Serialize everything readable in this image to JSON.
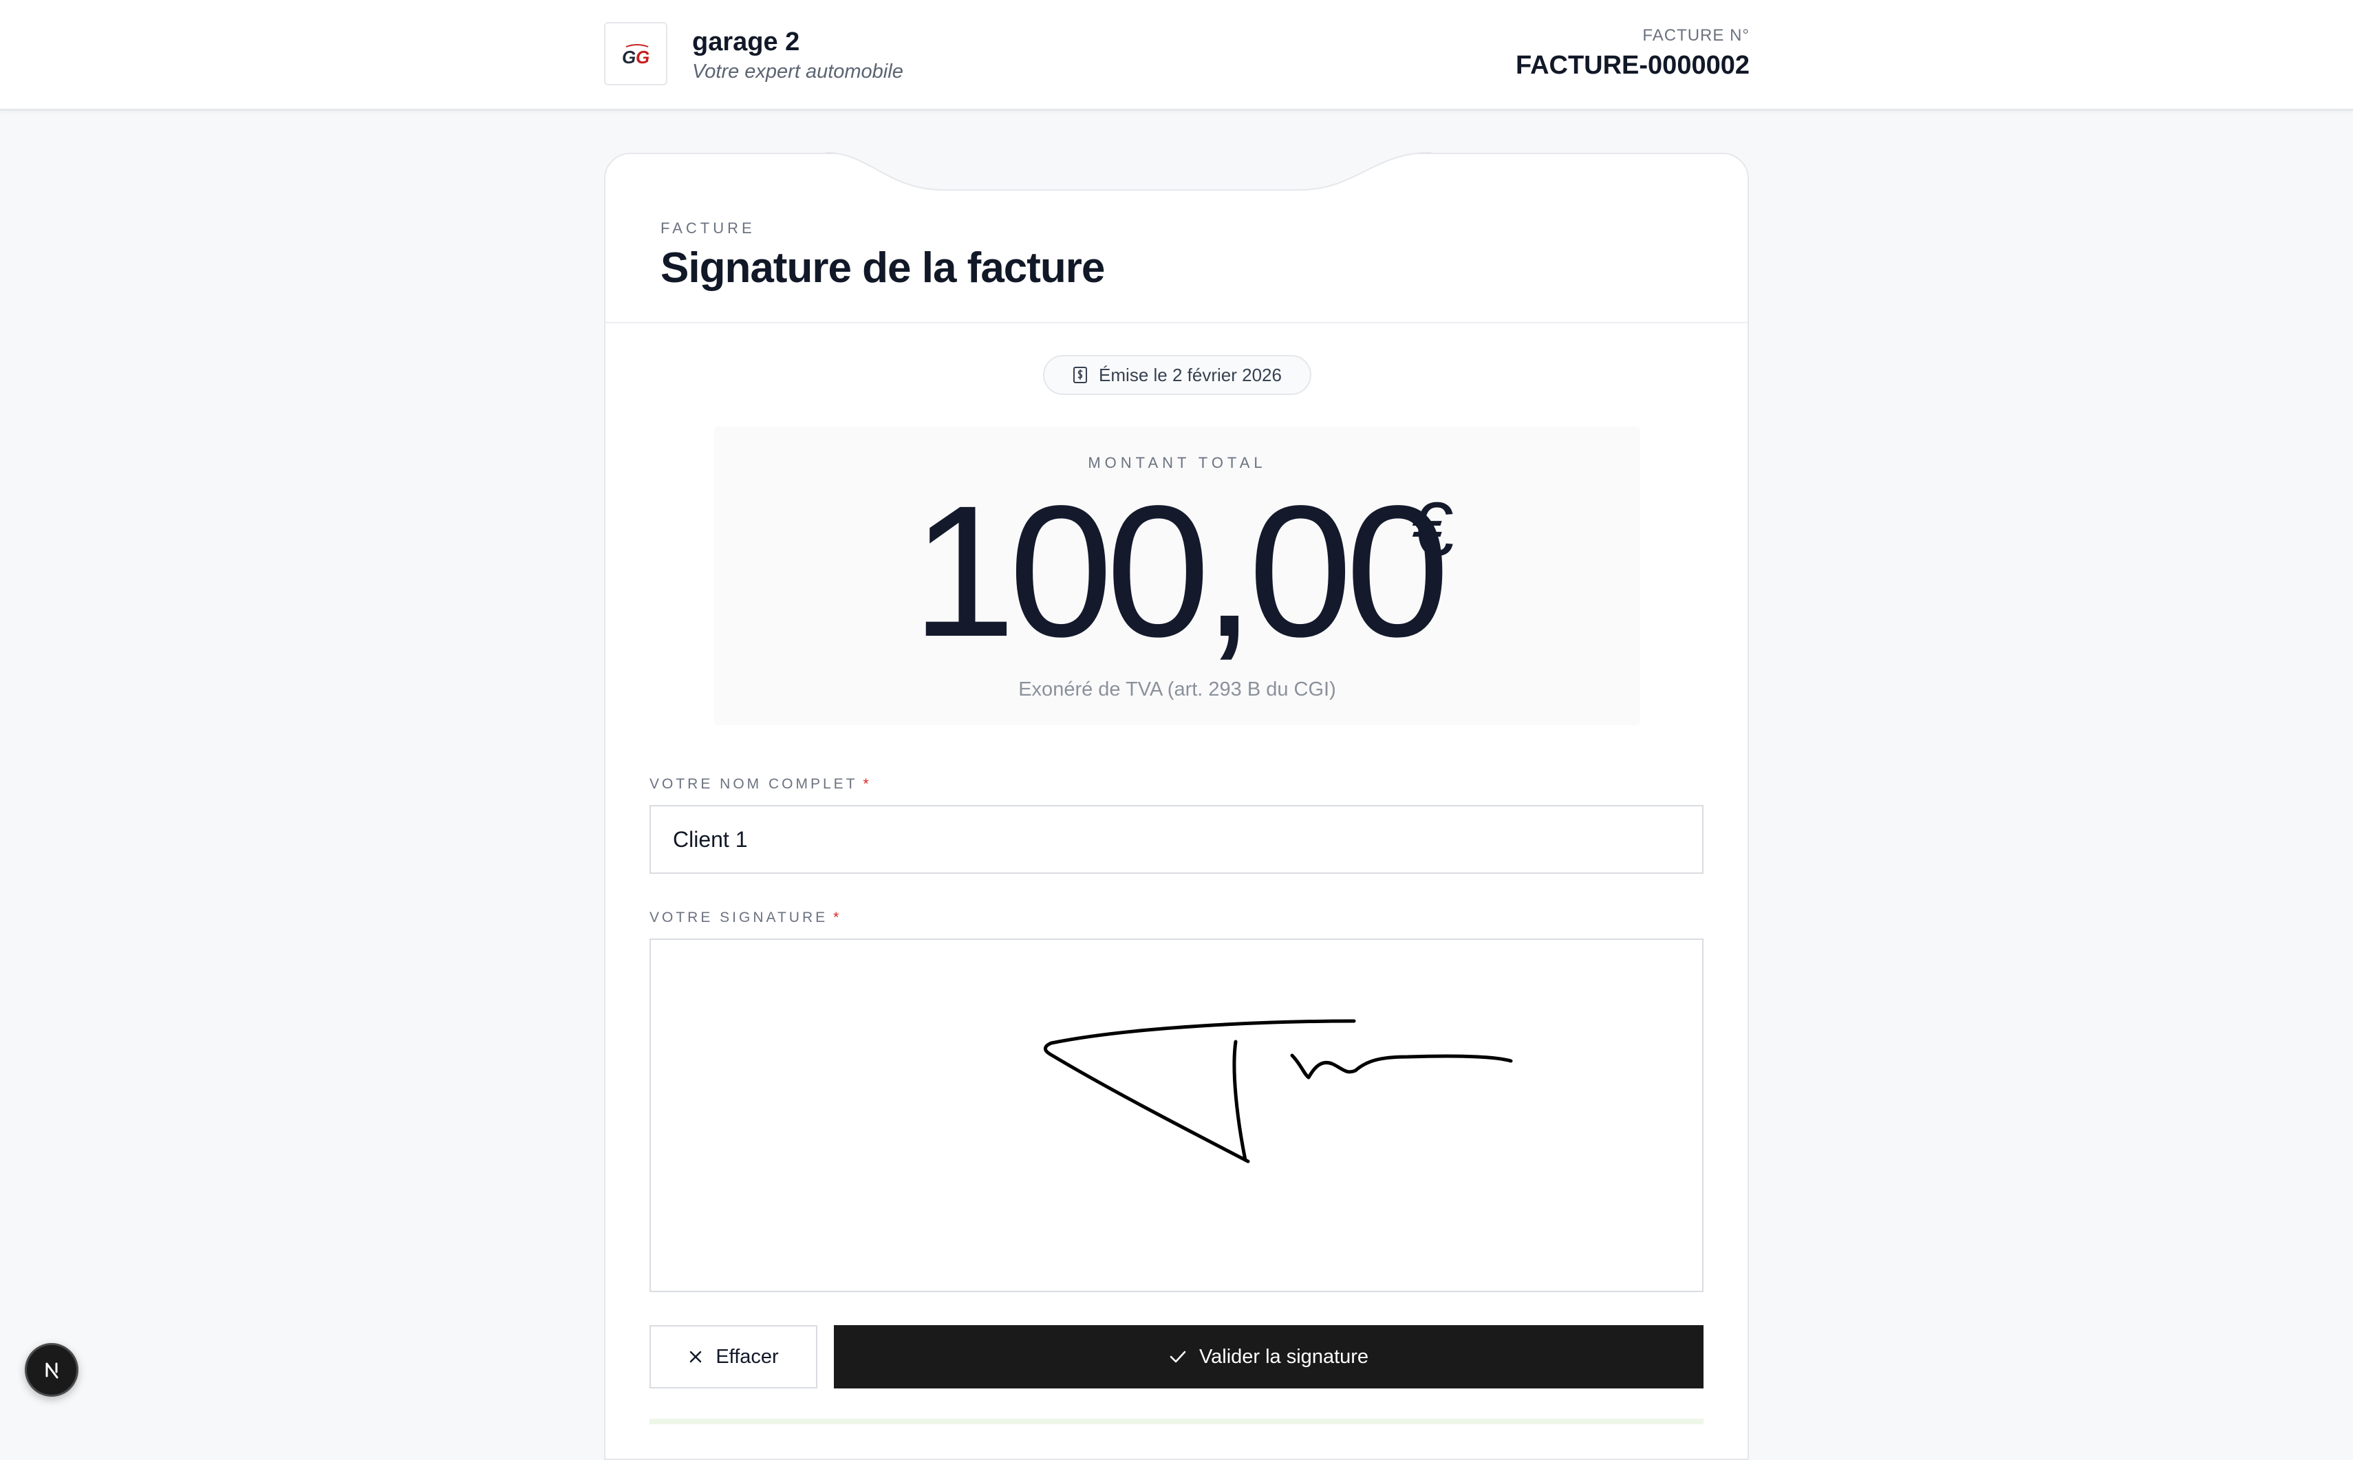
{
  "header": {
    "brand_name": "garage 2",
    "brand_tagline": "Votre expert automobile",
    "logo_text": "GG",
    "invoice_label": "FACTURE N°",
    "invoice_number": "FACTURE-0000002"
  },
  "card": {
    "eyebrow": "FACTURE",
    "title": "Signature de la facture",
    "date_pill": "Émise le 2 février 2026",
    "amount": {
      "label": "MONTANT TOTAL",
      "value": "100,00",
      "currency": "€",
      "note": "Exonéré de TVA (art. 293 B du CGI)"
    },
    "name_field": {
      "label": "VOTRE NOM COMPLET",
      "required_mark": "*",
      "value": "Client 1"
    },
    "signature_field": {
      "label": "VOTRE SIGNATURE",
      "required_mark": "*"
    },
    "buttons": {
      "clear_label": "Effacer",
      "validate_label": "Valider la signature"
    }
  },
  "icons": {
    "date": "receipt-icon",
    "clear": "close-icon",
    "validate": "check-icon",
    "dev": "nextjs-icon"
  },
  "colors": {
    "primary_button": "#1a1a1a",
    "required": "#dc2626",
    "page_bg": "#f7f8fa"
  }
}
